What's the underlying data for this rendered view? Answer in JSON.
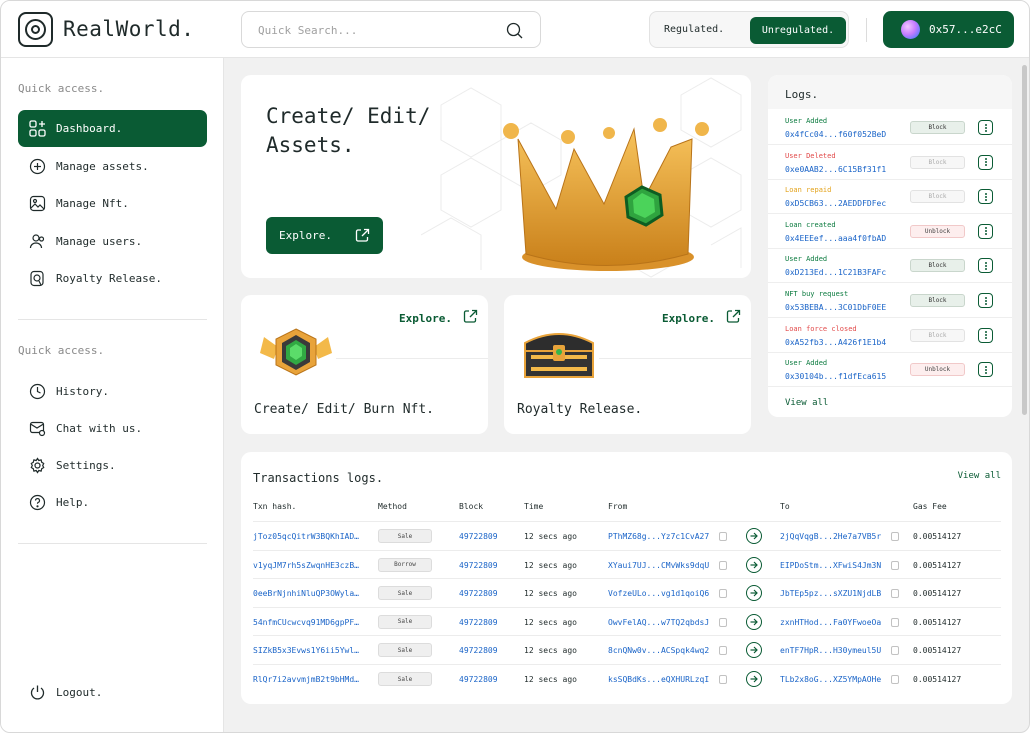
{
  "app": {
    "brand": "RealWorld."
  },
  "header": {
    "search_placeholder": "Quick Search...",
    "regulated": "Regulated.",
    "unregulated": "Unregulated.",
    "wallet": "0x57...e2cC"
  },
  "sidebar": {
    "quick_access_1": "Quick access.",
    "items": [
      {
        "label": "Dashboard.",
        "icon": "dashboard-icon"
      },
      {
        "label": "Manage assets.",
        "icon": "plus-circle-icon"
      },
      {
        "label": "Manage Nft.",
        "icon": "image-icon"
      },
      {
        "label": "Manage users.",
        "icon": "users-icon"
      },
      {
        "label": "Royalty Release.",
        "icon": "royalty-icon"
      }
    ],
    "quick_access_2": "Quick access.",
    "items2": [
      {
        "label": "History.",
        "icon": "history-icon"
      },
      {
        "label": "Chat with us.",
        "icon": "chat-icon"
      },
      {
        "label": "Settings.",
        "icon": "gear-icon"
      },
      {
        "label": "Help.",
        "icon": "help-icon"
      }
    ],
    "logout": "Logout."
  },
  "hero": {
    "title": "Create/ Edit/\nAssets.",
    "button": "Explore."
  },
  "cards": [
    {
      "explore": "Explore.",
      "title": "Create/ Edit/ Burn Nft."
    },
    {
      "explore": "Explore.",
      "title": "Royalty Release."
    }
  ],
  "logs": {
    "title": "Logs.",
    "view_all": "View all",
    "rows": [
      {
        "label": "User Added",
        "color": "#0a7a3e",
        "addr": "0x4fCc04...f60f052BeD",
        "action": "Block",
        "style": "block"
      },
      {
        "label": "User Deleted",
        "color": "#e24a4a",
        "addr": "0xe0AAB2...6C15Bf31f1",
        "action": "Block",
        "style": "muted"
      },
      {
        "label": "Loan repaid",
        "color": "#e3a21a",
        "addr": "0xD5CB63...2AEDDFDFec",
        "action": "Block",
        "style": "muted"
      },
      {
        "label": "Loan created",
        "color": "#0a7a3e",
        "addr": "0x4EEEef...aaa4f0fbAD",
        "action": "Unblock",
        "style": "unblock"
      },
      {
        "label": "User Added",
        "color": "#0a7a3e",
        "addr": "0xD213Ed...1C21B3FAFc",
        "action": "Block",
        "style": "block"
      },
      {
        "label": "NFT buy request",
        "color": "#0a7a3e",
        "addr": "0x53BEBA...3C01DbF0EE",
        "action": "Block",
        "style": "block"
      },
      {
        "label": "Loan force closed",
        "color": "#e24a4a",
        "addr": "0xA52fb3...A426f1E1b4",
        "action": "Block",
        "style": "muted"
      },
      {
        "label": "User Added",
        "color": "#0a7a3e",
        "addr": "0x30104b...f1dfEca615",
        "action": "Unblock",
        "style": "unblock"
      }
    ]
  },
  "transactions": {
    "title": "Transactions logs.",
    "view_all": "View all",
    "columns": [
      "Txn hash.",
      "Method",
      "Block",
      "Time",
      "From",
      "To",
      "Gas Fee"
    ],
    "rows": [
      {
        "hash": "jToz05qcQitrW3BQKhIAD…",
        "method": "Sale",
        "block": "49722809",
        "time": "12 secs ago",
        "from": "PThMZ68g...Yz7c1CvA27",
        "to": "2jQqVqgB...2He7a7VB5r",
        "fee": "0.00514127"
      },
      {
        "hash": "v1yqJM7rh5sZwqnHE3czB…",
        "method": "Borrow",
        "block": "49722809",
        "time": "12 secs ago",
        "from": "XYaui7UJ...CMvWks9dqU",
        "to": "EIPDoStm...XFwiS4Jm3N",
        "fee": "0.00514127"
      },
      {
        "hash": "0eeBrNjnhiNluQP3OWyla…",
        "method": "Sale",
        "block": "49722809",
        "time": "12 secs ago",
        "from": "VofzeULo...vg1d1qoiQ6",
        "to": "JbTEp5pz...sXZU1NjdLB",
        "fee": "0.00514127"
      },
      {
        "hash": "54nfmCUcwcvq91MD6gpPF…",
        "method": "Sale",
        "block": "49722809",
        "time": "12 secs ago",
        "from": "OwvFelAQ...w7TQ2qbdsJ",
        "to": "zxnHTHod...Fa0YFwoeOa",
        "fee": "0.00514127"
      },
      {
        "hash": "SIZkB5x3Evws1Y6ii5Ywl…",
        "method": "Sale",
        "block": "49722809",
        "time": "12 secs ago",
        "from": "8cnQNw0v...ACSpqk4wq2",
        "to": "enTF7HpR...H30ymeul5U",
        "fee": "0.00514127"
      },
      {
        "hash": "RlQr7i2avvmjmB2t9bHMd…",
        "method": "Sale",
        "block": "49722809",
        "time": "12 secs ago",
        "from": "ksSQBdKs...eQXHURLzqI",
        "to": "TLb2x8oG...XZ5YMpAOHe",
        "fee": "0.00514127"
      }
    ]
  },
  "colors": {
    "brand_green": "#0a5b34",
    "link_blue": "#1a64c8"
  }
}
